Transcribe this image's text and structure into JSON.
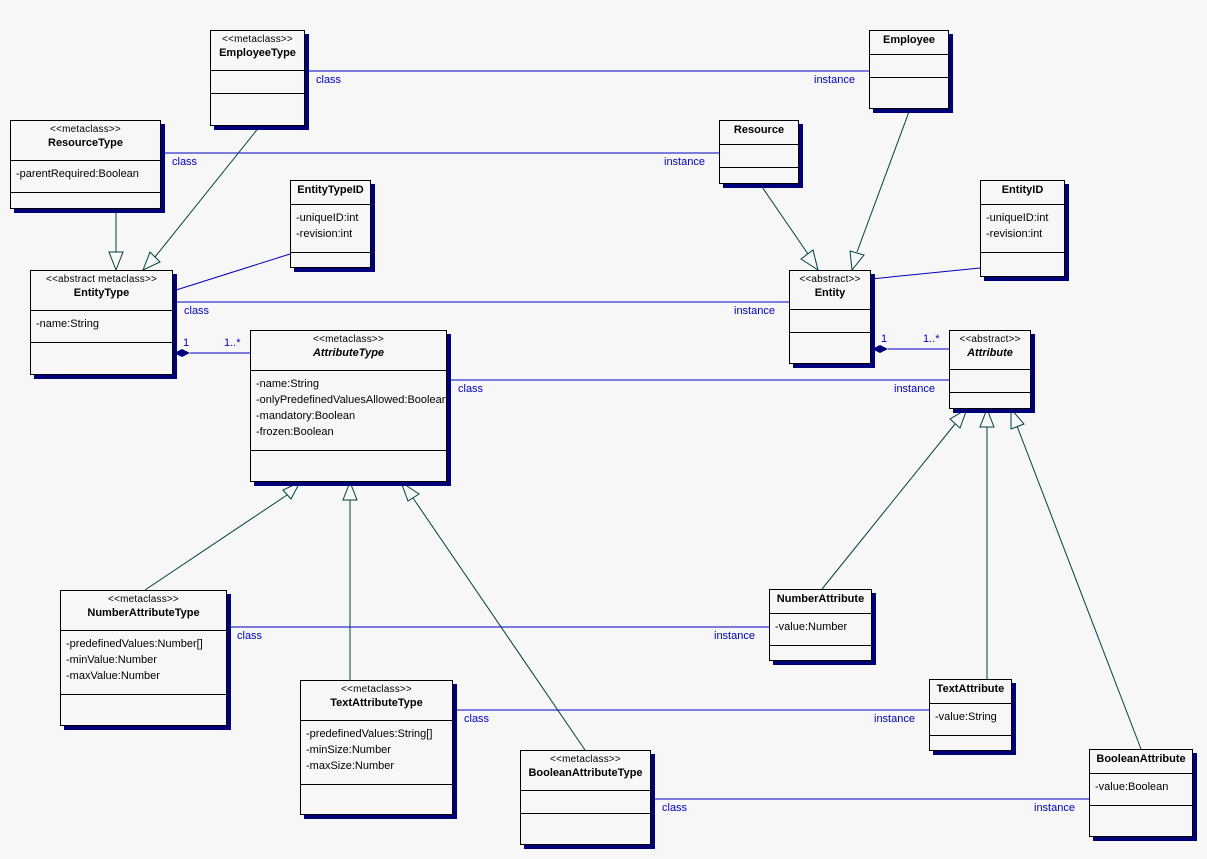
{
  "diagram": {
    "type": "UML class diagram",
    "colors": {
      "background": "#f7f7f7",
      "association": "#0000c0",
      "generalization": "#004040",
      "shadow": "#00007a",
      "box_border": "#000000"
    },
    "classes": {
      "employee_type": {
        "stereotype": "<<metaclass>>",
        "name": "EmployeeType",
        "attributes": []
      },
      "resource_type": {
        "stereotype": "<<metaclass>>",
        "name": "ResourceType",
        "attributes": [
          "-parentRequired:Boolean"
        ]
      },
      "entity_type_id": {
        "stereotype": "",
        "name": "EntityTypeID",
        "attributes": [
          "-uniqueID:int",
          "-revision:int"
        ]
      },
      "entity_type": {
        "stereotype": "<<abstract metaclass>>",
        "name": "EntityType",
        "attributes": [
          "-name:String"
        ]
      },
      "attribute_type": {
        "stereotype": "<<metaclass>>",
        "name": "AttributeType",
        "italic": true,
        "attributes": [
          "-name:String",
          "-onlyPredefinedValuesAllowed:Boolean",
          "-mandatory:Boolean",
          "-frozen:Boolean"
        ]
      },
      "employee": {
        "stereotype": "",
        "name": "Employee",
        "attributes": []
      },
      "resource": {
        "stereotype": "",
        "name": "Resource",
        "attributes": []
      },
      "entity_id": {
        "stereotype": "",
        "name": "EntityID",
        "attributes": [
          "-uniqueID:int",
          "-revision:int"
        ]
      },
      "entity": {
        "stereotype": "<<abstract>>",
        "name": "Entity",
        "attributes": []
      },
      "attribute": {
        "stereotype": "<<abstract>>",
        "name": "Attribute",
        "italic": true,
        "attributes": []
      },
      "number_attribute_type": {
        "stereotype": "<<metaclass>>",
        "name": "NumberAttributeType",
        "attributes": [
          "-predefinedValues:Number[]",
          "-minValue:Number",
          "-maxValue:Number"
        ]
      },
      "text_attribute_type": {
        "stereotype": "<<metaclass>>",
        "name": "TextAttributeType",
        "attributes": [
          "-predefinedValues:String[]",
          "-minSize:Number",
          "-maxSize:Number"
        ]
      },
      "boolean_attribute_type": {
        "stereotype": "<<metaclass>>",
        "name": "BooleanAttributeType",
        "attributes": []
      },
      "number_attribute": {
        "stereotype": "",
        "name": "NumberAttribute",
        "attributes": [
          "-value:Number"
        ]
      },
      "text_attribute": {
        "stereotype": "",
        "name": "TextAttribute",
        "attributes": [
          "-value:String"
        ]
      },
      "boolean_attribute": {
        "stereotype": "",
        "name": "BooleanAttribute",
        "attributes": [
          "-value:Boolean"
        ]
      }
    },
    "associations": [
      {
        "from": "EmployeeType",
        "to": "Employee",
        "from_label": "class",
        "to_label": "instance"
      },
      {
        "from": "ResourceType",
        "to": "Resource",
        "from_label": "class",
        "to_label": "instance"
      },
      {
        "from": "EntityType",
        "to": "Entity",
        "from_label": "class",
        "to_label": "instance"
      },
      {
        "from": "AttributeType",
        "to": "Attribute",
        "from_label": "class",
        "to_label": "instance"
      },
      {
        "from": "NumberAttributeType",
        "to": "NumberAttribute",
        "from_label": "class",
        "to_label": "instance"
      },
      {
        "from": "TextAttributeType",
        "to": "TextAttribute",
        "from_label": "class",
        "to_label": "instance"
      },
      {
        "from": "BooleanAttributeType",
        "to": "BooleanAttribute",
        "from_label": "class",
        "to_label": "instance"
      },
      {
        "from": "EntityType",
        "to": "EntityTypeID",
        "from_label": "",
        "to_label": ""
      },
      {
        "from": "Entity",
        "to": "EntityID",
        "from_label": "",
        "to_label": ""
      }
    ],
    "compositions": [
      {
        "whole": "EntityType",
        "part": "AttributeType",
        "whole_mult": "1",
        "part_mult": "1..*"
      },
      {
        "whole": "Entity",
        "part": "Attribute",
        "whole_mult": "1",
        "part_mult": "1..*"
      }
    ],
    "generalizations": [
      {
        "child": "ResourceType",
        "parent": "EntityType"
      },
      {
        "child": "EmployeeType",
        "parent": "EntityType"
      },
      {
        "child": "Resource",
        "parent": "Entity"
      },
      {
        "child": "Employee",
        "parent": "Entity"
      },
      {
        "child": "NumberAttributeType",
        "parent": "AttributeType"
      },
      {
        "child": "TextAttributeType",
        "parent": "AttributeType"
      },
      {
        "child": "BooleanAttributeType",
        "parent": "AttributeType"
      },
      {
        "child": "NumberAttribute",
        "parent": "Attribute"
      },
      {
        "child": "TextAttribute",
        "parent": "Attribute"
      },
      {
        "child": "BooleanAttribute",
        "parent": "Attribute"
      }
    ],
    "labels": {
      "class": "class",
      "instance": "instance",
      "mult_one": "1",
      "mult_many": "1..*"
    }
  }
}
